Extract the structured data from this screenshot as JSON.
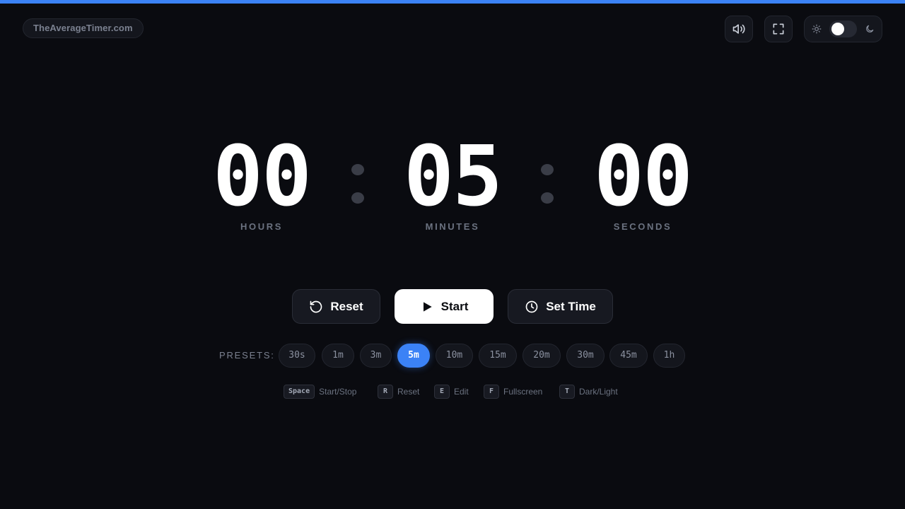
{
  "brand": "TheAverageTimer.com",
  "header": {
    "sound_icon": "speaker-icon",
    "fullscreen_icon": "fullscreen-icon",
    "theme": {
      "light_icon": "sun-icon",
      "dark_icon": "moon-icon",
      "mode": "dark"
    }
  },
  "timer": {
    "hours": "00",
    "minutes": "05",
    "seconds": "00",
    "hours_label": "HOURS",
    "minutes_label": "MINUTES",
    "seconds_label": "SECONDS"
  },
  "actions": {
    "reset": "Reset",
    "start": "Start",
    "set_time": "Set Time"
  },
  "presets": {
    "label": "PRESETS:",
    "items": [
      "30s",
      "1m",
      "3m",
      "5m",
      "10m",
      "15m",
      "20m",
      "30m",
      "45m",
      "1h"
    ],
    "active": "5m"
  },
  "shortcuts": [
    {
      "key": "Space",
      "action": "Start/Stop"
    },
    {
      "key": "R",
      "action": "Reset"
    },
    {
      "key": "E",
      "action": "Edit"
    },
    {
      "key": "F",
      "action": "Fullscreen"
    },
    {
      "key": "T",
      "action": "Dark/Light"
    }
  ],
  "colors": {
    "accent": "#3b82f6",
    "background": "#0a0b10"
  }
}
